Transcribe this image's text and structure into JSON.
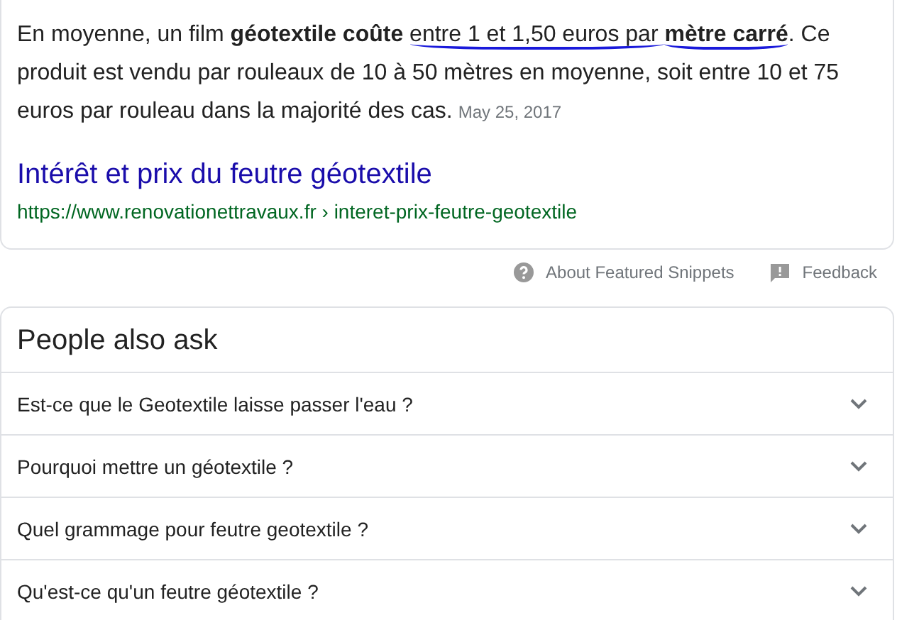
{
  "snippet": {
    "segments": [
      {
        "kind": "text",
        "text": "En moyenne, un film ",
        "bold": false,
        "underlined": false
      },
      {
        "kind": "text",
        "text": "géotextile coûte ",
        "bold": true,
        "underlined": false
      },
      {
        "kind": "text",
        "text": "entre 1 et 1,50 euros par ",
        "bold": false,
        "underlined": true
      },
      {
        "kind": "text",
        "text": "mètre carré",
        "bold": true,
        "underlined": true
      },
      {
        "kind": "text",
        "text": ". Ce produit est vendu par rouleaux de 10 à 50 mètres en moyenne, soit entre 10 et 75 euros par rouleau dans la majorité des cas.",
        "bold": false,
        "underlined": false
      },
      {
        "kind": "date",
        "text": "May 25, 2017"
      }
    ],
    "title": "Intérêt et prix du feutre géotextile",
    "url": "https://www.renovationettravaux.fr › interet-prix-feutre-geotextile"
  },
  "footer": {
    "about": "About Featured Snippets",
    "feedback": "Feedback"
  },
  "people_also_ask": {
    "heading": "People also ask",
    "questions": [
      {
        "text": "Est-ce que le Geotextile laisse passer l'eau ?",
        "expanded": false
      },
      {
        "text": "Pourquoi mettre un géotextile ?",
        "expanded": false
      },
      {
        "text": "Quel grammage pour feutre geotextile ?",
        "expanded": false
      },
      {
        "text": "Qu'est-ce qu'un feutre géotextile ?",
        "expanded": false
      }
    ]
  }
}
